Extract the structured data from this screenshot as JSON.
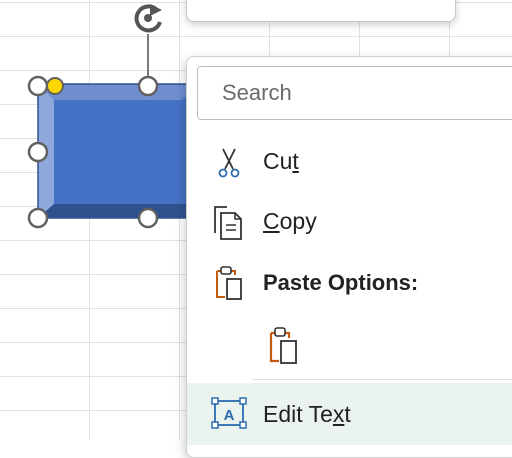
{
  "context_menu": {
    "search_placeholder": "Search",
    "items": {
      "cut": {
        "pre": "Cu",
        "accel": "t",
        "post": "",
        "icon": "scissors-icon"
      },
      "copy": {
        "pre": "",
        "accel": "C",
        "post": "opy",
        "icon": "copy-icon"
      },
      "paste_options": {
        "label": "Paste Options:",
        "icon": "clipboard-icon"
      },
      "paste_keep": {
        "icon": "paste-icon"
      },
      "edit_text": {
        "pre": "Edit Te",
        "accel": "x",
        "post": "t",
        "icon": "edit-text-icon"
      }
    }
  },
  "colors": {
    "shape_fill": "#4472c4",
    "shape_bevel_light": "#8fa8dc",
    "shape_bevel_dark": "#2f528f",
    "adjust_handle": "#ffd700",
    "hover_bg": "#eaf3ee",
    "icon_blue": "#2b6cb0",
    "icon_orange": "#c55a11"
  }
}
